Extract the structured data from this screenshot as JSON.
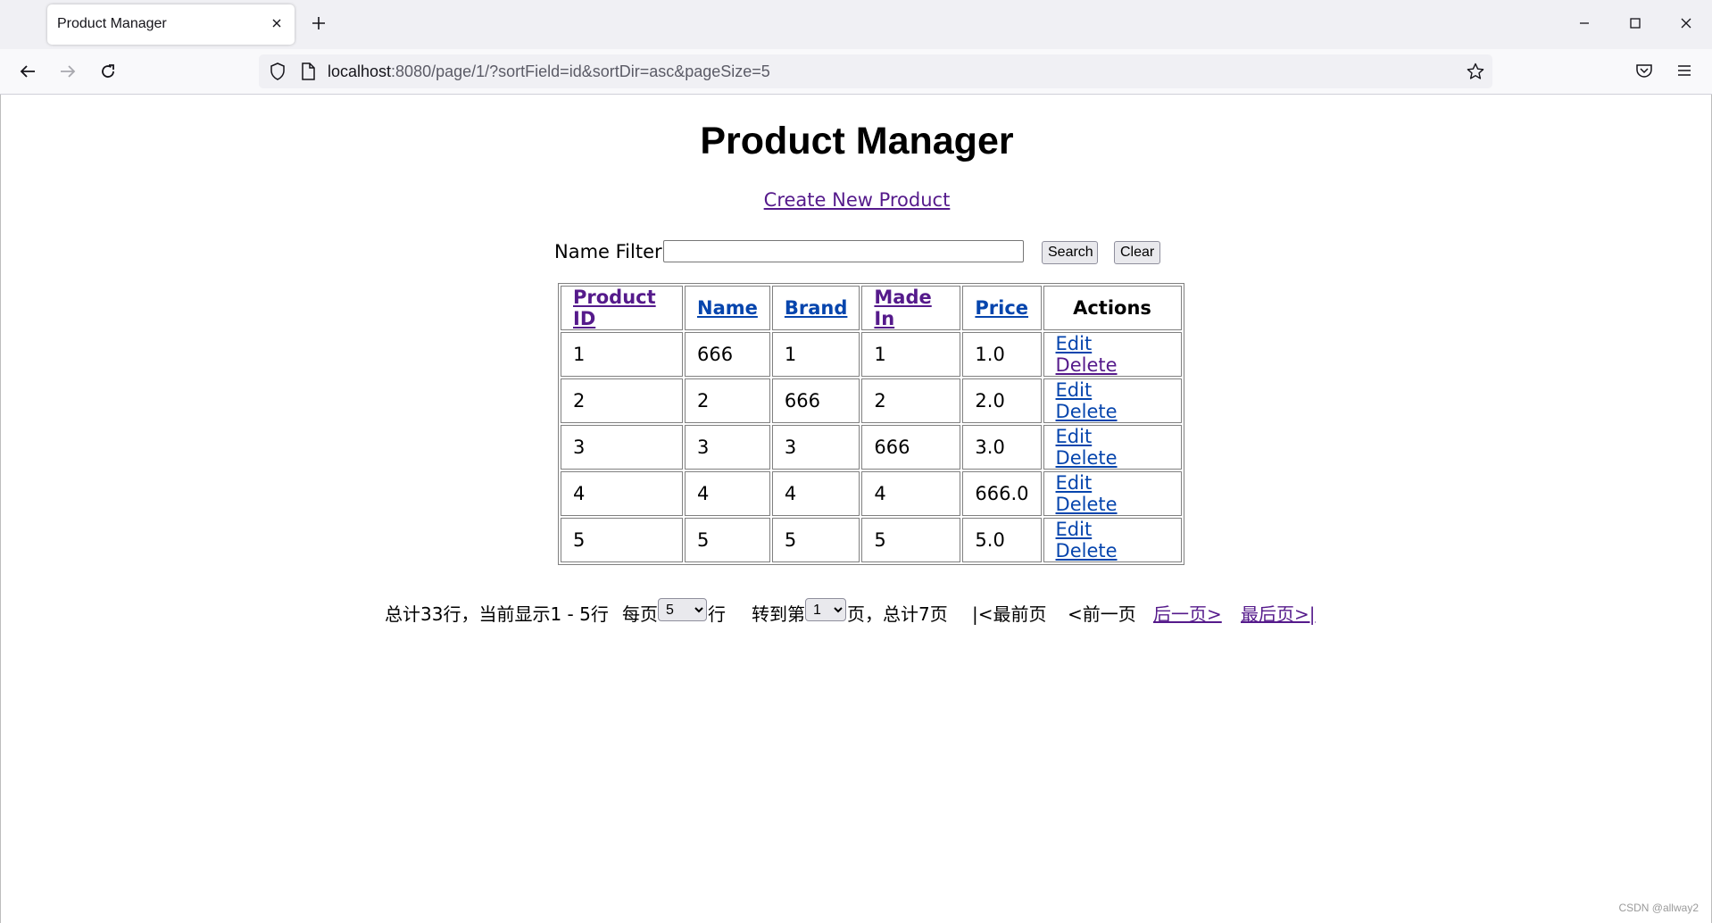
{
  "browser": {
    "tab_title": "Product Manager",
    "url_host": "localhost",
    "url_rest": ":8080/page/1/?sortField=id&sortDir=asc&pageSize=5"
  },
  "page": {
    "title": "Product Manager",
    "create_link": "Create New Product",
    "filter_label": "Name Filter:",
    "filter_value": "",
    "search_button": "Search",
    "clear_button": "Clear"
  },
  "table": {
    "headers": [
      "Product ID",
      "Name",
      "Brand",
      "Made In",
      "Price",
      "Actions"
    ],
    "rows": [
      {
        "id": "1",
        "name": "666",
        "brand": "1",
        "made_in": "1",
        "price": "1.0",
        "edit": "Edit",
        "delete": "Delete"
      },
      {
        "id": "2",
        "name": "2",
        "brand": "666",
        "made_in": "2",
        "price": "2.0",
        "edit": "Edit",
        "delete": "Delete"
      },
      {
        "id": "3",
        "name": "3",
        "brand": "3",
        "made_in": "666",
        "price": "3.0",
        "edit": "Edit",
        "delete": "Delete"
      },
      {
        "id": "4",
        "name": "4",
        "brand": "4",
        "made_in": "4",
        "price": "666.0",
        "edit": "Edit",
        "delete": "Delete"
      },
      {
        "id": "5",
        "name": "5",
        "brand": "5",
        "made_in": "5",
        "price": "5.0",
        "edit": "Edit",
        "delete": "Delete"
      }
    ]
  },
  "pagination": {
    "summary": "总计33行，当前显示1 - 5行",
    "per_page_prefix": "每页",
    "page_size": "5",
    "per_page_suffix": "行",
    "goto_prefix": "转到第",
    "current_page": "1",
    "goto_suffix": "页，总计7页",
    "first": "|<最前页",
    "prev": "<前一页",
    "next": "后一页>",
    "last": "最后页>|"
  },
  "watermark": "CSDN @allway2"
}
